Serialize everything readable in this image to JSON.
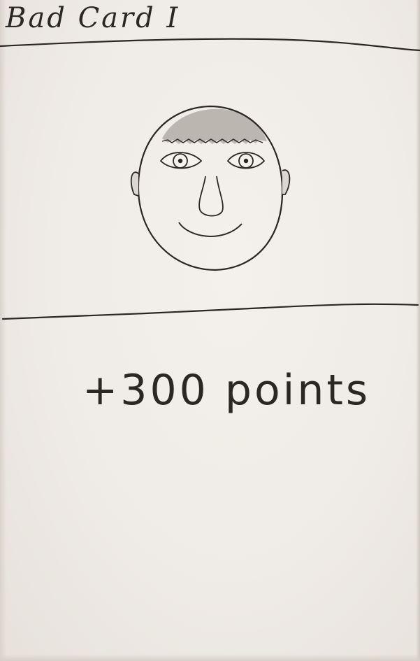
{
  "card": {
    "title": "Bad Card I",
    "effect_text": "+300 points"
  },
  "portrait": {
    "icon": "smiling-face-icon"
  },
  "colors": {
    "ink": "#2b2724",
    "paper": "#efebe6",
    "hair_shading": "#a9a39d"
  }
}
